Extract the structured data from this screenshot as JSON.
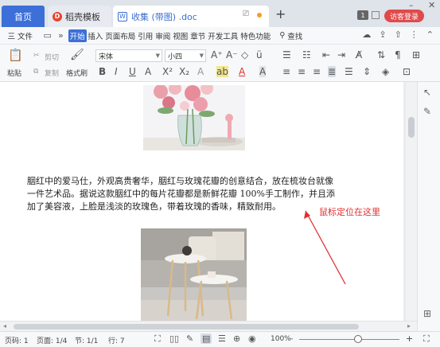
{
  "tabs": {
    "home": "首页",
    "template": "稻壳模板",
    "document": "收集 (带图) .doc",
    "new_tab": "+",
    "login": "访客登录"
  },
  "menu": {
    "file": "三 文件",
    "items": [
      "开始",
      "插入",
      "页面布局",
      "引用",
      "审阅",
      "视图",
      "章节",
      "开发工具",
      "特色功能"
    ],
    "active": "开始",
    "search": "查找"
  },
  "toolbar": {
    "paste": "粘贴",
    "cut": "剪切",
    "copy": "复制",
    "format_painter": "格式刷",
    "font_name": "宋体",
    "font_size": "小四"
  },
  "document": {
    "paragraph_lines": [
      "胭红中的爱马仕，外观高贵奢华，胭红与玫瑰花瓣的创意结合，放在梳妆台就像",
      "一件艺术品。据说这款胭红中的每片花瓣都是新鲜花瓣 100%手工制作，并且添",
      "加了美容液，上脸是浅淡的玫瑰色，带着玫瑰的香味，精致耐用。"
    ],
    "annotation": "鼠标定位在这里"
  },
  "status": {
    "page_num": "页码: 1",
    "pages": "页面: 1/4",
    "section": "节: 1/1",
    "row": "行: 7",
    "zoom": "100%",
    "zoom_level": 0.59
  },
  "colors": {
    "accent": "#3c6fd8",
    "annotation": "#e03030",
    "login": "#e04a4a"
  }
}
